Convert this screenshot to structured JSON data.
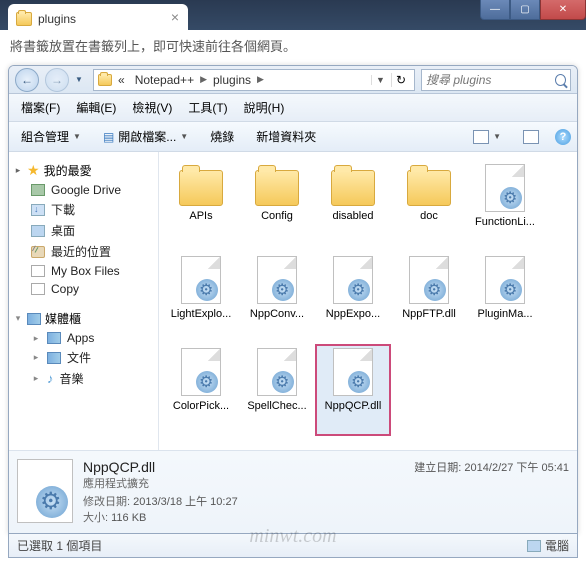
{
  "tab": {
    "title": "plugins",
    "close": "×"
  },
  "winbuttons": {
    "min": "—",
    "max": "▢",
    "close": "✕"
  },
  "hint": "將書籤放置在書籤列上，即可快速前往各個網頁。",
  "nav": {
    "back": "←",
    "fwd": "→"
  },
  "breadcrumb": {
    "root": "«",
    "p1": "Notepad++",
    "p2": "plugins"
  },
  "search": {
    "placeholder": "搜尋 plugins"
  },
  "menu": {
    "file": "檔案(F)",
    "edit": "編輯(E)",
    "view": "檢視(V)",
    "tools": "工具(T)",
    "help": "說明(H)"
  },
  "toolbar": {
    "organize": "組合管理",
    "open": "開啟檔案...",
    "burn": "燒錄",
    "newfolder": "新增資料夾"
  },
  "sidebar": {
    "fav": "我的最愛",
    "fav_items": [
      "Google Drive",
      "下載",
      "桌面",
      "最近的位置",
      "My Box Files",
      "Copy"
    ],
    "lib": "媒體櫃",
    "lib_items": [
      "Apps",
      "文件",
      "音樂"
    ]
  },
  "files": [
    {
      "name": "APIs",
      "type": "folder"
    },
    {
      "name": "Config",
      "type": "folder"
    },
    {
      "name": "disabled",
      "type": "folder"
    },
    {
      "name": "doc",
      "type": "folder"
    },
    {
      "name": "FunctionLi...",
      "type": "dll"
    },
    {
      "name": "LightExplo...",
      "type": "dll"
    },
    {
      "name": "NppConv...",
      "type": "dll"
    },
    {
      "name": "NppExpo...",
      "type": "dll"
    },
    {
      "name": "NppFTP.dll",
      "type": "dll"
    },
    {
      "name": "PluginMa...",
      "type": "dll"
    },
    {
      "name": "ColorPick...",
      "type": "dll"
    },
    {
      "name": "SpellChec...",
      "type": "dll"
    },
    {
      "name": "NppQCP.dll",
      "type": "dll",
      "selected": true
    }
  ],
  "details": {
    "name": "NppQCP.dll",
    "type": "應用程式擴充",
    "modified_label": "修改日期:",
    "modified": "2013/3/18 上午 10:27",
    "size_label": "大小:",
    "size": "116 KB",
    "created_label": "建立日期:",
    "created": "2014/2/27 下午 05:41"
  },
  "status": {
    "left": "已選取 1 個項目",
    "right": "電腦"
  },
  "watermark": "minwt.com"
}
